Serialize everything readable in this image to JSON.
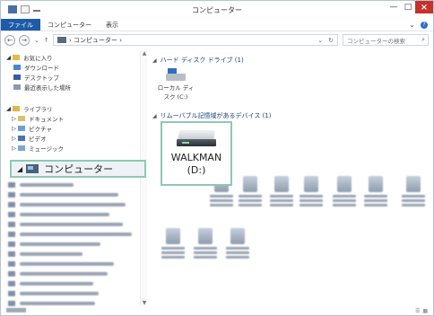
{
  "window": {
    "title": "コンピューター",
    "controls": {
      "minimize": "—",
      "maximize": "□",
      "close": "×"
    }
  },
  "ribbon": {
    "tabs": [
      "ファイル",
      "コンピューター",
      "表示"
    ],
    "help": "?"
  },
  "address_bar": {
    "path": "コンピューター",
    "search_placeholder": "コンピューターの検索"
  },
  "nav_pane": {
    "favorites": {
      "label": "お気に入り",
      "items": [
        "ダウンロード",
        "デスクトップ",
        "最近表示した場所"
      ]
    },
    "libraries": {
      "label": "ライブラリ",
      "items": [
        "ドキュメント",
        "ピクチャ",
        "ビデオ",
        "ミュージック"
      ]
    },
    "computer_label": "コンピューター"
  },
  "content": {
    "hdd_group": "ハード ディスク ドライブ (1)",
    "local_disk": {
      "line1": "ローカル ディ",
      "line2": "スク (C:)"
    },
    "removable_group": "リムーバブル記憶域があるデバイス (1)",
    "walkman": {
      "name": "WALKMAN",
      "drive": "(D:)"
    }
  },
  "colors": {
    "file_tab": "#1e5ba8",
    "close_button": "#c7312b",
    "callout_border": "#8fc8b4",
    "group_header_text": "#1a3e7a"
  }
}
